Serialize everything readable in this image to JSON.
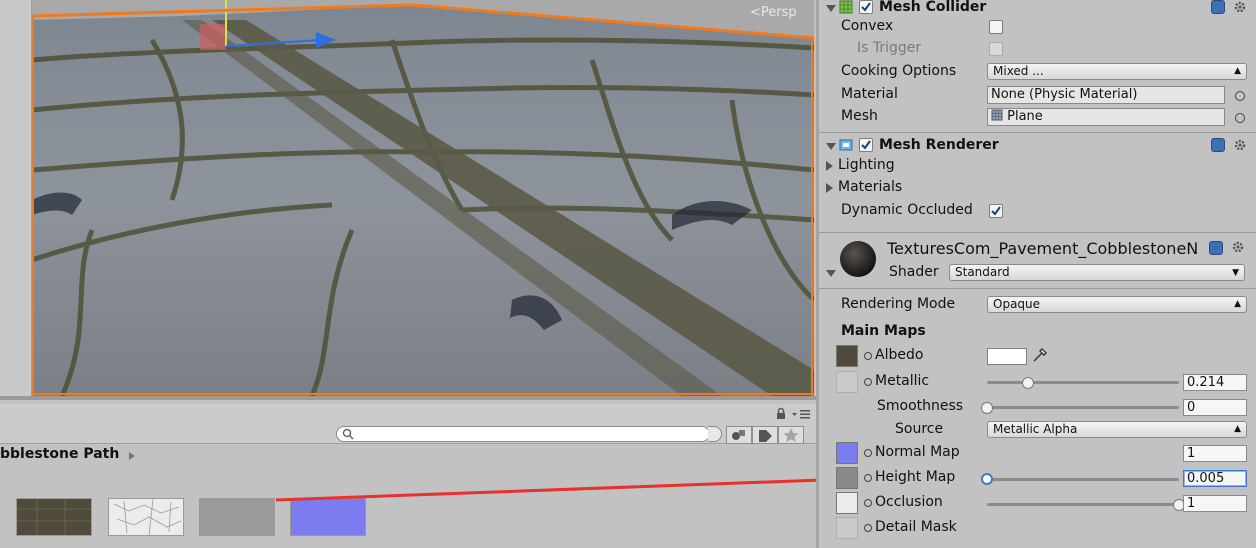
{
  "scene": {
    "persp_label": "<Persp"
  },
  "project": {
    "breadcrumb": "bblestone Path",
    "search_placeholder": "",
    "thumbnails": [
      {
        "name": "albedo-thumb",
        "color": "#4f4a3c"
      },
      {
        "name": "height-thumb",
        "color": "#ececec"
      },
      {
        "name": "occlusion-thumb",
        "color": "#9b9b9b"
      },
      {
        "name": "normal-thumb",
        "color": "#7b7cf0"
      }
    ]
  },
  "inspector": {
    "mesh_collider": {
      "title": "Mesh Collider",
      "convex_label": "Convex",
      "convex_checked": false,
      "is_trigger_label": "Is Trigger",
      "is_trigger_checked": false,
      "cooking_options_label": "Cooking Options",
      "cooking_options_value": "Mixed ...",
      "material_label": "Material",
      "material_value": "None (Physic Material)",
      "mesh_label": "Mesh",
      "mesh_value": "Plane"
    },
    "mesh_renderer": {
      "title": "Mesh Renderer",
      "lighting_label": "Lighting",
      "materials_label": "Materials",
      "dynamic_occluded_label": "Dynamic Occluded",
      "dynamic_occluded_checked": true
    },
    "material": {
      "name": "TexturesCom_Pavement_CobblestoneN",
      "shader_label": "Shader",
      "shader_value": "Standard",
      "rendering_mode_label": "Rendering Mode",
      "rendering_mode_value": "Opaque",
      "main_maps_label": "Main Maps",
      "albedo_label": "Albedo",
      "metallic_label": "Metallic",
      "metallic_value": "0.214",
      "metallic_fraction": 0.214,
      "smoothness_label": "Smoothness",
      "smoothness_value": "0",
      "smoothness_fraction": 0,
      "source_label": "Source",
      "source_value": "Metallic Alpha",
      "normal_map_label": "Normal Map",
      "normal_map_value": "1",
      "height_map_label": "Height Map",
      "height_map_value": "0.005",
      "height_map_fraction": 0,
      "occlusion_label": "Occlusion",
      "occlusion_value": "1",
      "occlusion_fraction": 1,
      "detail_mask_label": "Detail Mask"
    }
  },
  "colors": {
    "selection_outline": "#f07a1e",
    "annotation_arrow": "#e8302c",
    "focus_blue": "#3b78d8"
  }
}
